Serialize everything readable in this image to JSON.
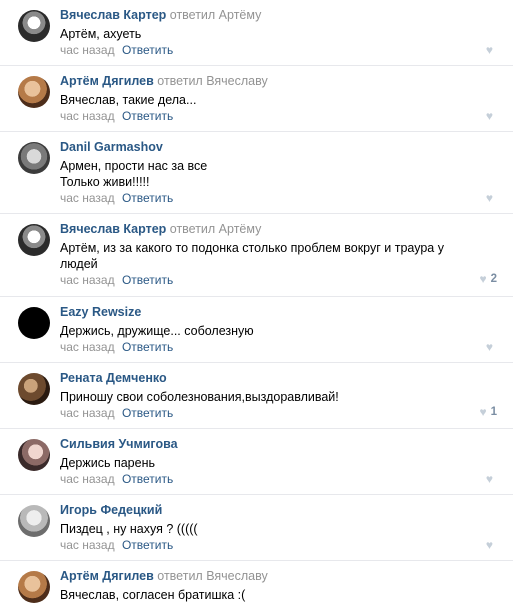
{
  "comments": [
    {
      "author": "Вячеслав Картер",
      "replied": "ответил Артёму",
      "text": "Артём, ахуеть",
      "time": "час назад",
      "reply": "Ответить",
      "likes": ""
    },
    {
      "author": "Артём Дягилев",
      "replied": "ответил Вячеславу",
      "text": "Вячеслав, такие дела...",
      "time": "час назад",
      "reply": "Ответить",
      "likes": ""
    },
    {
      "author": "Danil Garmashov",
      "replied": "",
      "text": "Армен, прости нас за все\nТолько живи!!!!!",
      "time": "час назад",
      "reply": "Ответить",
      "likes": ""
    },
    {
      "author": "Вячеслав Картер",
      "replied": "ответил Артёму",
      "text": "Артём, из за какого то подонка столько проблем вокруг и траура у людей",
      "time": "час назад",
      "reply": "Ответить",
      "likes": "2"
    },
    {
      "author": "Eazy Rewsize",
      "replied": "",
      "text": "Держись, дружище... соболезную",
      "time": "час назад",
      "reply": "Ответить",
      "likes": ""
    },
    {
      "author": "Рената Демченко",
      "replied": "",
      "text": "Приношу свои соболезнования,выздоравливай!",
      "time": "час назад",
      "reply": "Ответить",
      "likes": "1"
    },
    {
      "author": "Сильвия Учмигова",
      "replied": "",
      "text": "Держись парень",
      "time": "час назад",
      "reply": "Ответить",
      "likes": ""
    },
    {
      "author": "Игорь Федецкий",
      "replied": "",
      "text": "Пиздец , ну нахуя ? (((((",
      "time": "час назад",
      "reply": "Ответить",
      "likes": ""
    },
    {
      "author": "Артём Дягилев",
      "replied": "ответил Вячеславу",
      "text": "Вячеслав, согласен братишка :(",
      "time": "",
      "reply": "",
      "likes": ""
    }
  ],
  "icons": {
    "like": "heart-icon"
  },
  "colors": {
    "link": "#2a5885",
    "muted": "#939393",
    "divider": "#e7e8ec",
    "like": "#c5cfd9"
  }
}
